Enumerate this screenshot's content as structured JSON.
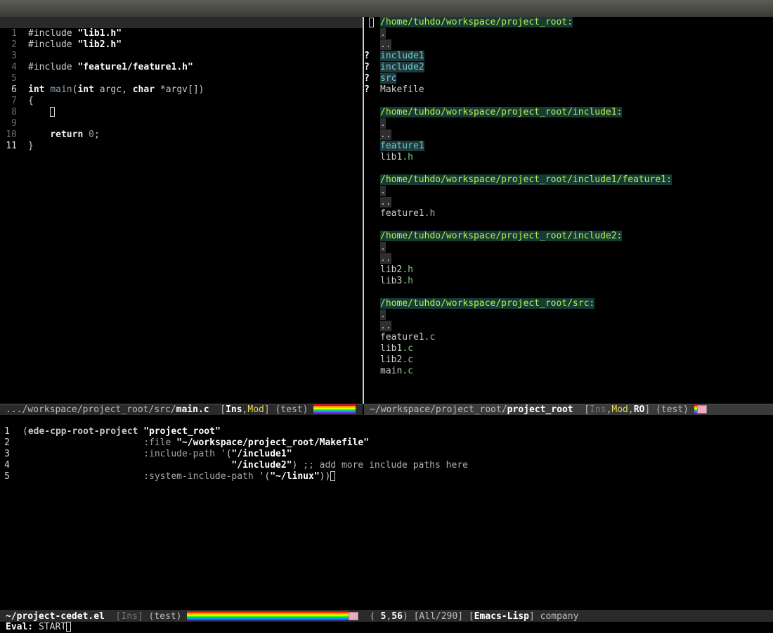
{
  "left_editor": {
    "lines": [
      {
        "n": "1"
      },
      {
        "n": "2"
      },
      {
        "n": "3"
      },
      {
        "n": "4"
      },
      {
        "n": "5"
      },
      {
        "n": "6"
      },
      {
        "n": "7"
      },
      {
        "n": "8"
      },
      {
        "n": "9"
      },
      {
        "n": "10"
      },
      {
        "n": "11"
      }
    ],
    "inc1_dir": "#include ",
    "inc1_file": "\"lib1.h\"",
    "inc2_dir": "#include ",
    "inc2_file": "\"lib2.h\"",
    "inc3_dir": "#include ",
    "inc3_file": "\"feature1/feature1.h\"",
    "l6_int": "int",
    "l6_main": "main",
    "l6_open": "(",
    "l6_int2": "int",
    "l6_argc": " argc, ",
    "l6_char": "char",
    "l6_argv": " *argv[])",
    "l7": "{",
    "l10_return": "return",
    "l10_zero": "0",
    "l10_semi": ";",
    "l11": "}"
  },
  "right_dired": {
    "sections": [
      {
        "header": "/home/tuhdo/workspace/project_root:"
      },
      {
        "header": "/home/tuhdo/workspace/project_root/include1:"
      },
      {
        "header": "/home/tuhdo/workspace/project_root/include1/feature1:"
      },
      {
        "header": "/home/tuhdo/workspace/project_root/include2:"
      },
      {
        "header": "/home/tuhdo/workspace/project_root/src:"
      }
    ],
    "dot": ".",
    "dotdot": "..",
    "mark": "?",
    "entries": {
      "include1": "include1",
      "include2": "include2",
      "src": "src",
      "makefile": "Makefile",
      "feature1_dir": "feature1",
      "lib1_base": "lib1",
      "lib1_ext": ".h",
      "feature1h_base": "feature1",
      "feature1h_ext": ".h",
      "lib2h_base": "lib2",
      "lib2h_ext": ".h",
      "lib3h_base": "lib3",
      "lib3h_ext": ".h",
      "f1c_base": "feature1",
      "f1c_ext": ".c",
      "l1c_base": "lib1",
      "l1c_ext": ".c",
      "l2c_base": "lib2",
      "l2c_ext": ".c",
      "mainc_base": "main",
      "mainc_ext": ".c"
    }
  },
  "modeline_left": {
    "path": ".../workspace/project_root/src/",
    "file": "main.c",
    "open": "  [",
    "ins": "Ins",
    "comma": ",",
    "mod": "Mod",
    "close": "]",
    "minor": " (test) "
  },
  "modeline_right": {
    "path": "~/workspace/project_root/",
    "file": "project_root",
    "open": "  [",
    "ins": "Ins",
    "comma": ",",
    "mod": "Mod",
    "comma2": ",",
    "ro": "RO",
    "close": "]",
    "minor": " (test) "
  },
  "bottom_editor": {
    "l1_open": "(",
    "l1_fn": "ede-cpp-root-project",
    "l1_str": "\"project_root\"",
    "l2_kw": ":file",
    "l2_str": "\"~/workspace/project_root/Makefile\"",
    "l3_kw": ":include-path",
    "l3_q": " '(",
    "l3_str": "\"/include1\"",
    "l4_str": "\"/include2\"",
    "l4_close": ")",
    "l4_cmt": " ;; add more include paths here",
    "l5_kw": ":system-include-path",
    "l5_q": " '(",
    "l5_str": "\"~/linux\"",
    "l5_close": "))"
  },
  "modeline_bottom": {
    "file": "~/project-cedet.el",
    "ins": "[Ins]",
    "minor": " (test) ",
    "pos_open": "  ( ",
    "line": "5",
    "comma": ",",
    "col": "56",
    "pos_close": ")",
    "all": " [All/290] ",
    "mode_open": "[",
    "mode": "Emacs-Lisp",
    "mode_close": "]",
    "company": " company"
  },
  "echo": {
    "label": "Eval:",
    "value": " START"
  },
  "colors": {
    "dired_header_bg": "#123c34",
    "dired_header_fg": "#c8e64a",
    "dir_fg": "#6ec6d2",
    "ext_fg": "#7fd07f",
    "mod_fg": "#e6db4a"
  }
}
